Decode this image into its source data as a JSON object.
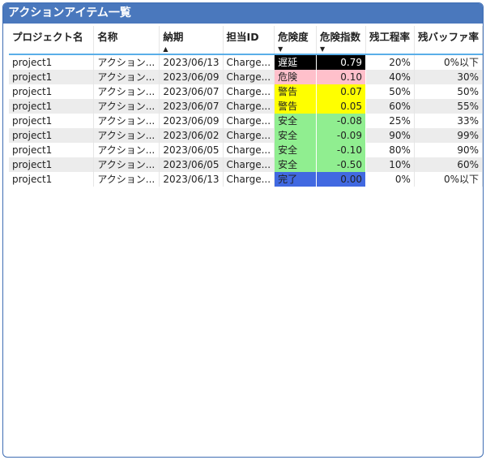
{
  "title": "アクションアイテム一覧",
  "columns": [
    {
      "label": "プロジェクト名",
      "sort": ""
    },
    {
      "label": "名称",
      "sort": ""
    },
    {
      "label": "納期",
      "sort": "▲"
    },
    {
      "label": "担当ID",
      "sort": ""
    },
    {
      "label": "危険度",
      "sort": "▼"
    },
    {
      "label": "危険指数",
      "sort": "▼"
    },
    {
      "label": "残工程率",
      "sort": ""
    },
    {
      "label": "残バッファ率",
      "sort": ""
    }
  ],
  "rows": [
    {
      "project": "project1",
      "name": "アクション...",
      "due": "2023/06/13",
      "assignee": "Charge...",
      "risk": "遅延",
      "index": "0.79",
      "remaining": "20%",
      "buffer": "0%以下"
    },
    {
      "project": "project1",
      "name": "アクション...",
      "due": "2023/06/09",
      "assignee": "Charge...",
      "risk": "危険",
      "index": "0.10",
      "remaining": "40%",
      "buffer": "30%"
    },
    {
      "project": "project1",
      "name": "アクション...",
      "due": "2023/06/07",
      "assignee": "Charge...",
      "risk": "警告",
      "index": "0.07",
      "remaining": "50%",
      "buffer": "50%"
    },
    {
      "project": "project1",
      "name": "アクション...",
      "due": "2023/06/07",
      "assignee": "Charge...",
      "risk": "警告",
      "index": "0.05",
      "remaining": "60%",
      "buffer": "55%"
    },
    {
      "project": "project1",
      "name": "アクション...",
      "due": "2023/06/09",
      "assignee": "Charge...",
      "risk": "安全",
      "index": "-0.08",
      "remaining": "25%",
      "buffer": "33%"
    },
    {
      "project": "project1",
      "name": "アクション...",
      "due": "2023/06/02",
      "assignee": "Charge...",
      "risk": "安全",
      "index": "-0.09",
      "remaining": "90%",
      "buffer": "99%"
    },
    {
      "project": "project1",
      "name": "アクション...",
      "due": "2023/06/05",
      "assignee": "Charge...",
      "risk": "安全",
      "index": "-0.10",
      "remaining": "80%",
      "buffer": "90%"
    },
    {
      "project": "project1",
      "name": "アクション...",
      "due": "2023/06/05",
      "assignee": "Charge...",
      "risk": "安全",
      "index": "-0.50",
      "remaining": "10%",
      "buffer": "60%"
    },
    {
      "project": "project1",
      "name": "アクション...",
      "due": "2023/06/13",
      "assignee": "Charge...",
      "risk": "完了",
      "index": "0.00",
      "remaining": "0%",
      "buffer": "0%以下"
    }
  ],
  "risk_colors": {
    "遅延": {
      "bg": "#000000",
      "fg": "#ffffff"
    },
    "危険": {
      "bg": "#ffc0cb",
      "fg": "#222222"
    },
    "警告": {
      "bg": "#ffff00",
      "fg": "#222222"
    },
    "安全": {
      "bg": "#90ee90",
      "fg": "#222222"
    },
    "完了": {
      "bg": "#4169e1",
      "fg": "#222222"
    }
  },
  "colors": {
    "title_bar": "#4a78bd",
    "header_underline": "#5aaee8",
    "odd_row": "#ececec"
  }
}
